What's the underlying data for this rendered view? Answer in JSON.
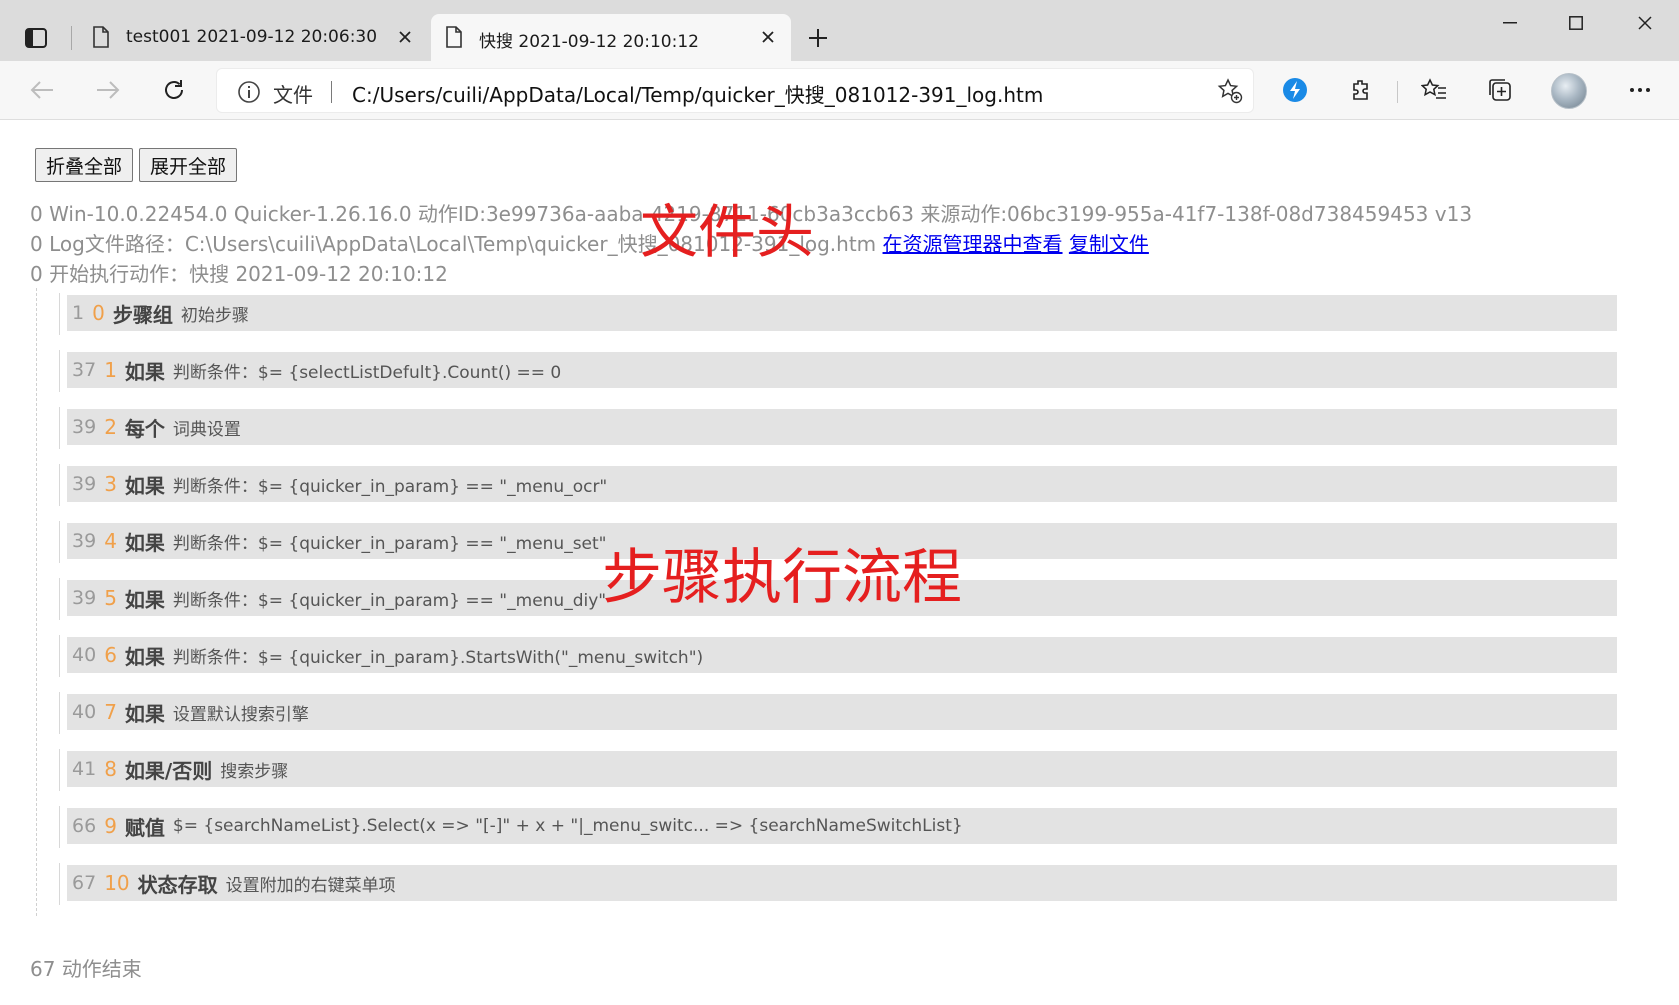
{
  "tabs": [
    {
      "title": "test001 2021-09-12 20:06:30",
      "active": false
    },
    {
      "title": "快搜 2021-09-12 20:10:12",
      "active": true
    }
  ],
  "address": {
    "scheme_label": "文件",
    "url": "C:/Users/cuili/AppData/Local/Temp/quicker_快搜_081012-391_log.htm"
  },
  "page": {
    "collapse_all": "折叠全部",
    "expand_all": "展开全部",
    "info_lines": [
      {
        "num": "0",
        "text": "Win-10.0.22454.0 Quicker-1.26.16.0 动作ID:3e99736a-aaba-4219-8711-60cb3a3ccb63 来源动作:06bc3199-955a-41f7-138f-08d738459453 v13"
      },
      {
        "num": "0",
        "text": "Log文件路径：C:\\Users\\cuili\\AppData\\Local\\Temp\\quicker_快搜_081012-391_log.htm"
      },
      {
        "num": "0",
        "text": "开始执行动作：快搜 2021-09-12 20:10:12"
      }
    ],
    "link_view_in_explorer": "在资源管理器中查看",
    "link_copy_file": "复制文件",
    "steps": [
      {
        "line": "1",
        "index": "0",
        "type": "步骤组",
        "desc": "初始步骤"
      },
      {
        "line": "37",
        "index": "1",
        "type": "如果",
        "desc": "判断条件：$= {selectListDefult}.Count() == 0"
      },
      {
        "line": "39",
        "index": "2",
        "type": "每个",
        "desc": "词典设置"
      },
      {
        "line": "39",
        "index": "3",
        "type": "如果",
        "desc": "判断条件：$= {quicker_in_param} == \"_menu_ocr\""
      },
      {
        "line": "39",
        "index": "4",
        "type": "如果",
        "desc": "判断条件：$= {quicker_in_param} == \"_menu_set\""
      },
      {
        "line": "39",
        "index": "5",
        "type": "如果",
        "desc": "判断条件：$= {quicker_in_param} == \"_menu_diy\""
      },
      {
        "line": "40",
        "index": "6",
        "type": "如果",
        "desc": "判断条件：$= {quicker_in_param}.StartsWith(\"_menu_switch\")"
      },
      {
        "line": "40",
        "index": "7",
        "type": "如果",
        "desc": "设置默认搜索引擎"
      },
      {
        "line": "41",
        "index": "8",
        "type": "如果/否则",
        "desc": "搜索步骤"
      },
      {
        "line": "66",
        "index": "9",
        "type": "赋值",
        "desc": "$= {searchNameList}.Select(x => \"[-]\" + x + \"|_menu_switc... => {searchNameSwitchList}"
      },
      {
        "line": "67",
        "index": "10",
        "type": "状态存取",
        "desc": "设置附加的右键菜单项"
      }
    ],
    "footer": {
      "num": "67",
      "text": "动作结束"
    }
  },
  "annotations": {
    "file_header": "文件头",
    "step_flow": "步骤执行流程"
  },
  "colors": {
    "annotation": "#e51f1f",
    "step_index": "#f0a04a",
    "link": "#0000ee",
    "step_bar": "#e3e3e3"
  }
}
